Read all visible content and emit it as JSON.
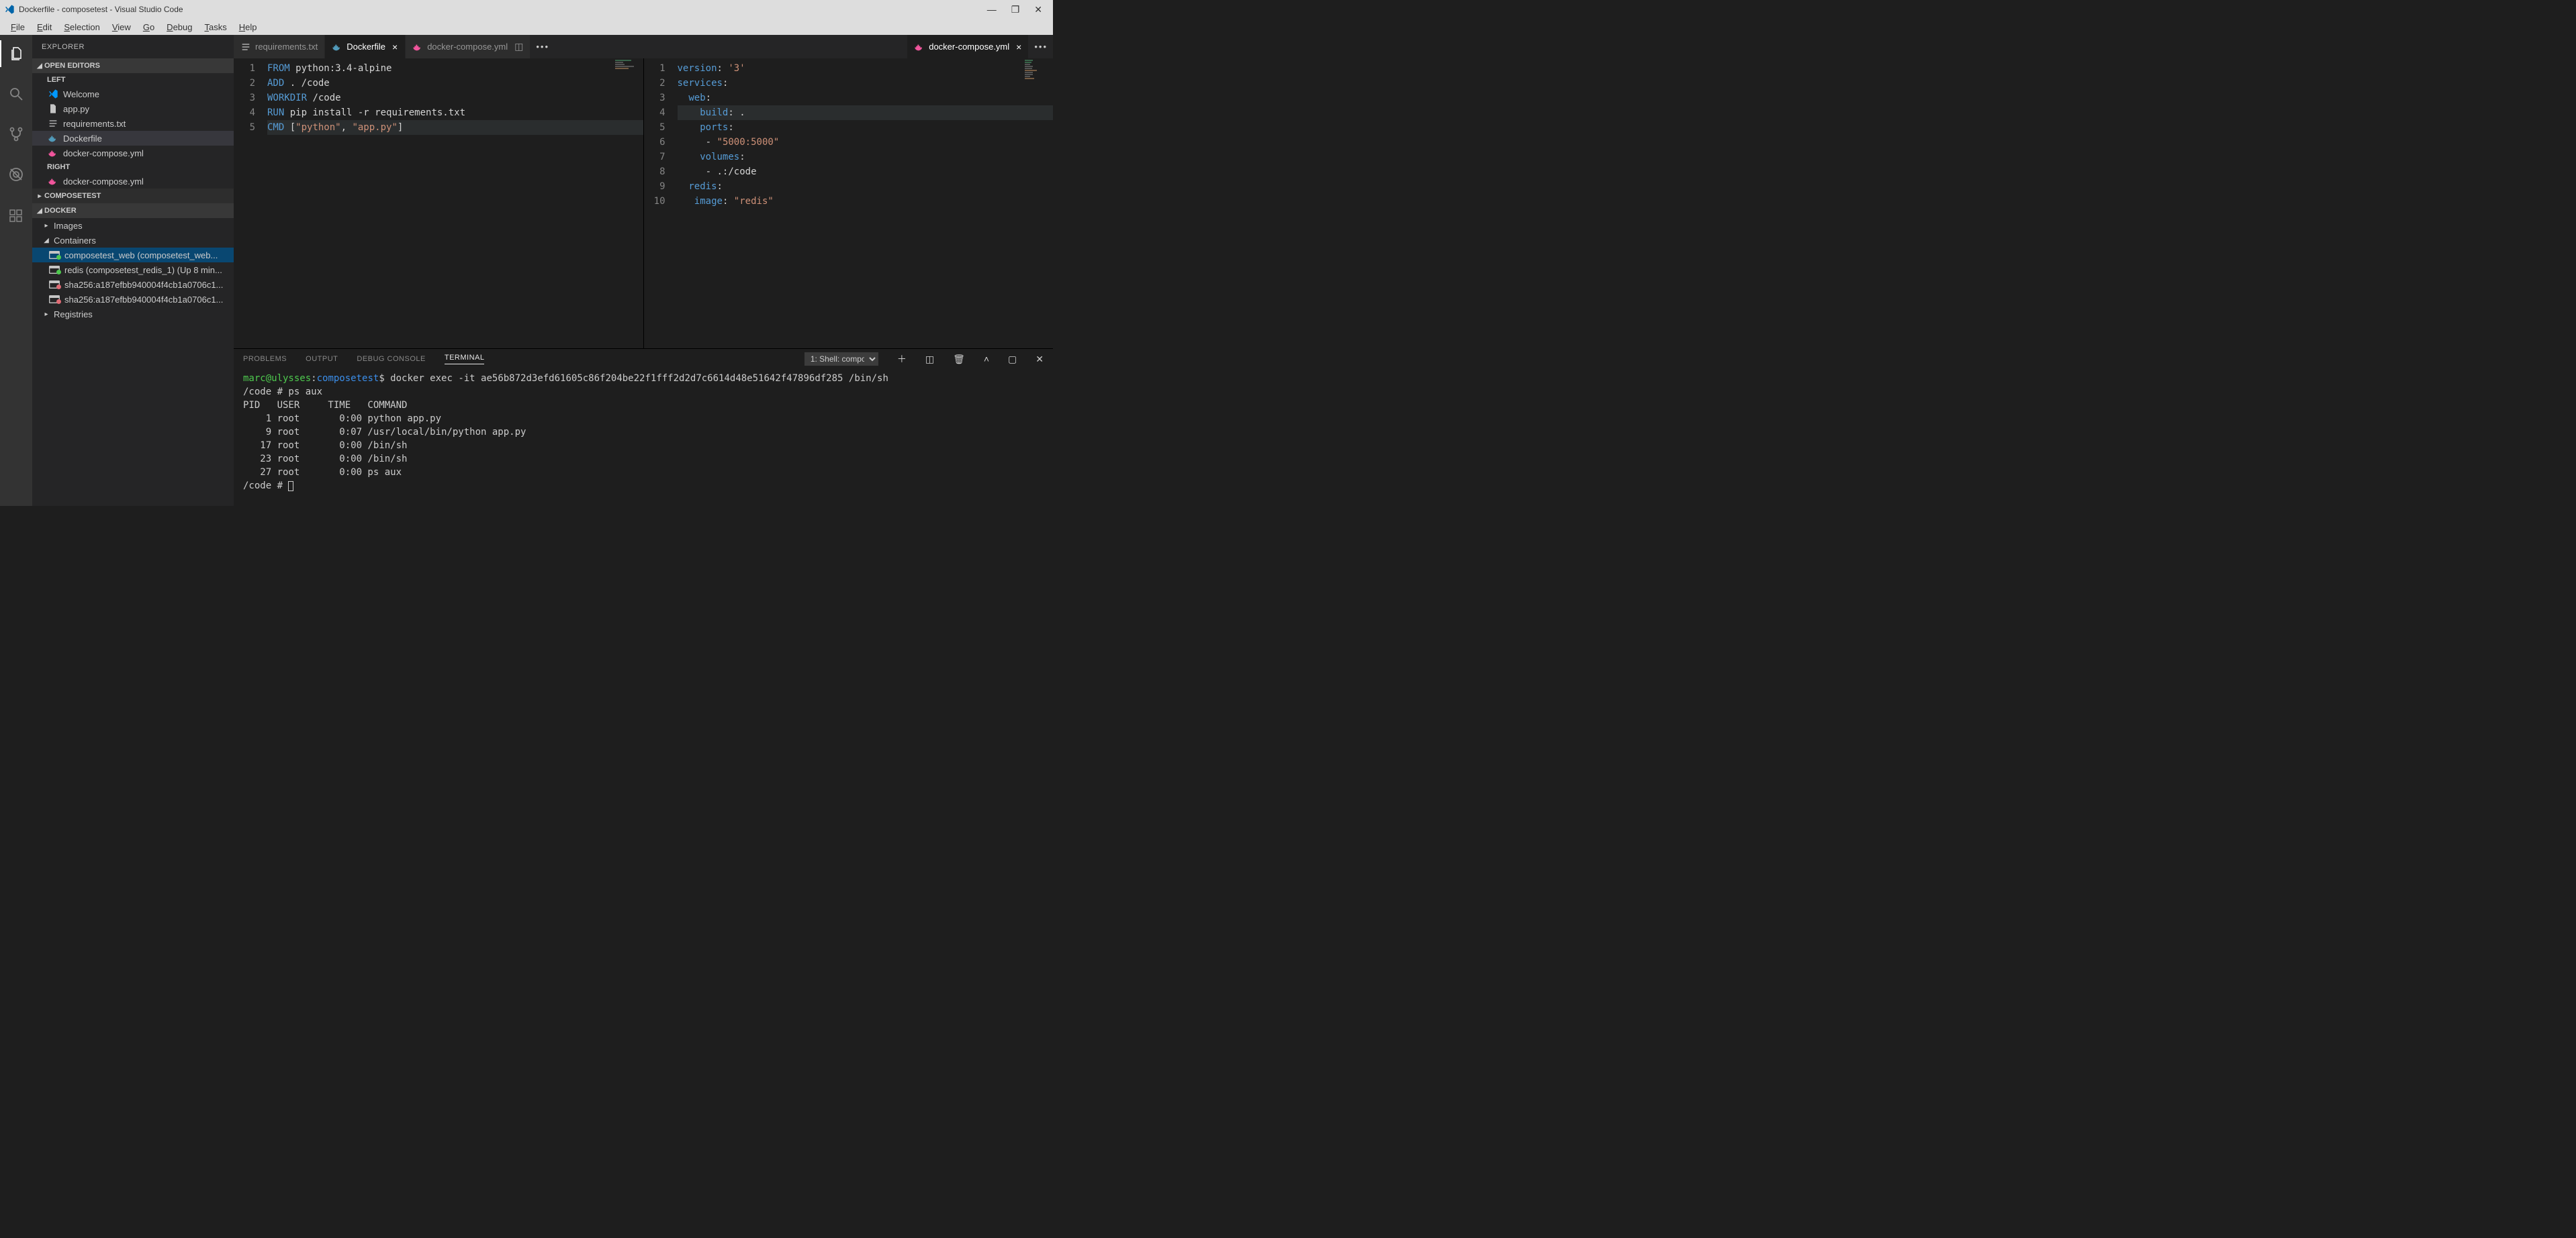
{
  "title_bar": {
    "text": "Dockerfile - composetest - Visual Studio Code"
  },
  "menu": {
    "items": [
      "File",
      "Edit",
      "Selection",
      "View",
      "Go",
      "Debug",
      "Tasks",
      "Help"
    ]
  },
  "sidebar": {
    "title": "EXPLORER",
    "open_editors_label": "OPEN EDITORS",
    "groups": {
      "left_label": "LEFT",
      "right_label": "RIGHT",
      "left": [
        {
          "label": "Welcome",
          "icon": "vscode"
        },
        {
          "label": "app.py",
          "icon": "file"
        },
        {
          "label": "requirements.txt",
          "icon": "lines"
        },
        {
          "label": "Dockerfile",
          "icon": "docker",
          "active": true
        },
        {
          "label": "docker-compose.yml",
          "icon": "compose"
        }
      ],
      "right": [
        {
          "label": "docker-compose.yml",
          "icon": "compose"
        }
      ]
    },
    "project_label": "COMPOSETEST",
    "docker_section": {
      "label": "DOCKER",
      "images_label": "Images",
      "containers_label": "Containers",
      "containers": [
        {
          "label": "composetest_web (composetest_web...",
          "status": "green",
          "selected": true
        },
        {
          "label": "redis (composetest_redis_1) (Up 8 min...",
          "status": "green"
        },
        {
          "label": "sha256:a187efbb940004f4cb1a0706c1...",
          "status": "red"
        },
        {
          "label": "sha256:a187efbb940004f4cb1a0706c1...",
          "status": "red"
        }
      ],
      "registries_label": "Registries"
    }
  },
  "tabs": {
    "left_group": [
      {
        "label": "requirements.txt",
        "icon": "lines"
      },
      {
        "label": "Dockerfile",
        "icon": "docker",
        "active": true,
        "close": true
      },
      {
        "label": "docker-compose.yml",
        "icon": "compose",
        "split": true
      }
    ],
    "right_group": [
      {
        "label": "docker-compose.yml",
        "icon": "compose",
        "active": true,
        "close": true
      }
    ]
  },
  "editor_left": {
    "lines": [
      "1",
      "2",
      "3",
      "4",
      "5"
    ],
    "content": [
      [
        {
          "t": "FROM",
          "c": "kw"
        },
        {
          "t": " python:3.4-alpine",
          "c": "cmdtxt"
        }
      ],
      [
        {
          "t": "ADD",
          "c": "kw"
        },
        {
          "t": " . /code",
          "c": "cmdtxt"
        }
      ],
      [
        {
          "t": "WORKDIR",
          "c": "kw"
        },
        {
          "t": " /code",
          "c": "cmdtxt"
        }
      ],
      [
        {
          "t": "RUN",
          "c": "kw"
        },
        {
          "t": " pip install -r requirements.txt",
          "c": "cmdtxt"
        }
      ],
      [
        {
          "t": "CMD",
          "c": "kw"
        },
        {
          "t": " [",
          "c": "punc"
        },
        {
          "t": "\"python\"",
          "c": "str"
        },
        {
          "t": ", ",
          "c": "punc"
        },
        {
          "t": "\"app.py\"",
          "c": "str"
        },
        {
          "t": "]",
          "c": "punc"
        }
      ]
    ],
    "current_line": 5
  },
  "editor_right": {
    "lines": [
      "1",
      "2",
      "3",
      "4",
      "5",
      "6",
      "7",
      "8",
      "9",
      "10"
    ],
    "content": [
      [
        {
          "t": "version",
          "c": "key"
        },
        {
          "t": ": ",
          "c": "punc"
        },
        {
          "t": "'3'",
          "c": "val"
        }
      ],
      [
        {
          "t": "services",
          "c": "key"
        },
        {
          "t": ":",
          "c": "punc"
        }
      ],
      [
        {
          "t": "  web",
          "c": "key"
        },
        {
          "t": ":",
          "c": "punc"
        }
      ],
      [
        {
          "t": "    build",
          "c": "key"
        },
        {
          "t": ": .",
          "c": "cmdtxt"
        }
      ],
      [
        {
          "t": "    ports",
          "c": "key"
        },
        {
          "t": ":",
          "c": "punc"
        }
      ],
      [
        {
          "t": "     - ",
          "c": "cmdtxt"
        },
        {
          "t": "\"5000:5000\"",
          "c": "val"
        }
      ],
      [
        {
          "t": "    volumes",
          "c": "key"
        },
        {
          "t": ":",
          "c": "punc"
        }
      ],
      [
        {
          "t": "     - .:/code",
          "c": "cmdtxt"
        }
      ],
      [
        {
          "t": "  redis",
          "c": "key"
        },
        {
          "t": ":",
          "c": "punc"
        }
      ],
      [
        {
          "t": "   image",
          "c": "key"
        },
        {
          "t": ": ",
          "c": "punc"
        },
        {
          "t": "\"redis\"",
          "c": "val"
        }
      ]
    ],
    "current_line": 4
  },
  "panel": {
    "tabs": [
      "PROBLEMS",
      "OUTPUT",
      "DEBUG CONSOLE",
      "TERMINAL"
    ],
    "active_tab": "TERMINAL",
    "term_selector": "1: Shell: compo",
    "terminal": {
      "prompt_user": "marc@ulysses",
      "prompt_sep": ":",
      "prompt_path": "composetest",
      "prompt_char": "$",
      "command": "docker exec -it ae56b872d3efd61605c86f204be22f1fff2d2d7c6614d48e51642f47896df285 /bin/sh",
      "lines": [
        "/code # ps aux",
        "PID   USER     TIME   COMMAND",
        "    1 root       0:00 python app.py",
        "    9 root       0:07 /usr/local/bin/python app.py",
        "   17 root       0:00 /bin/sh",
        "   23 root       0:00 /bin/sh",
        "   27 root       0:00 ps aux",
        "/code # "
      ]
    }
  }
}
